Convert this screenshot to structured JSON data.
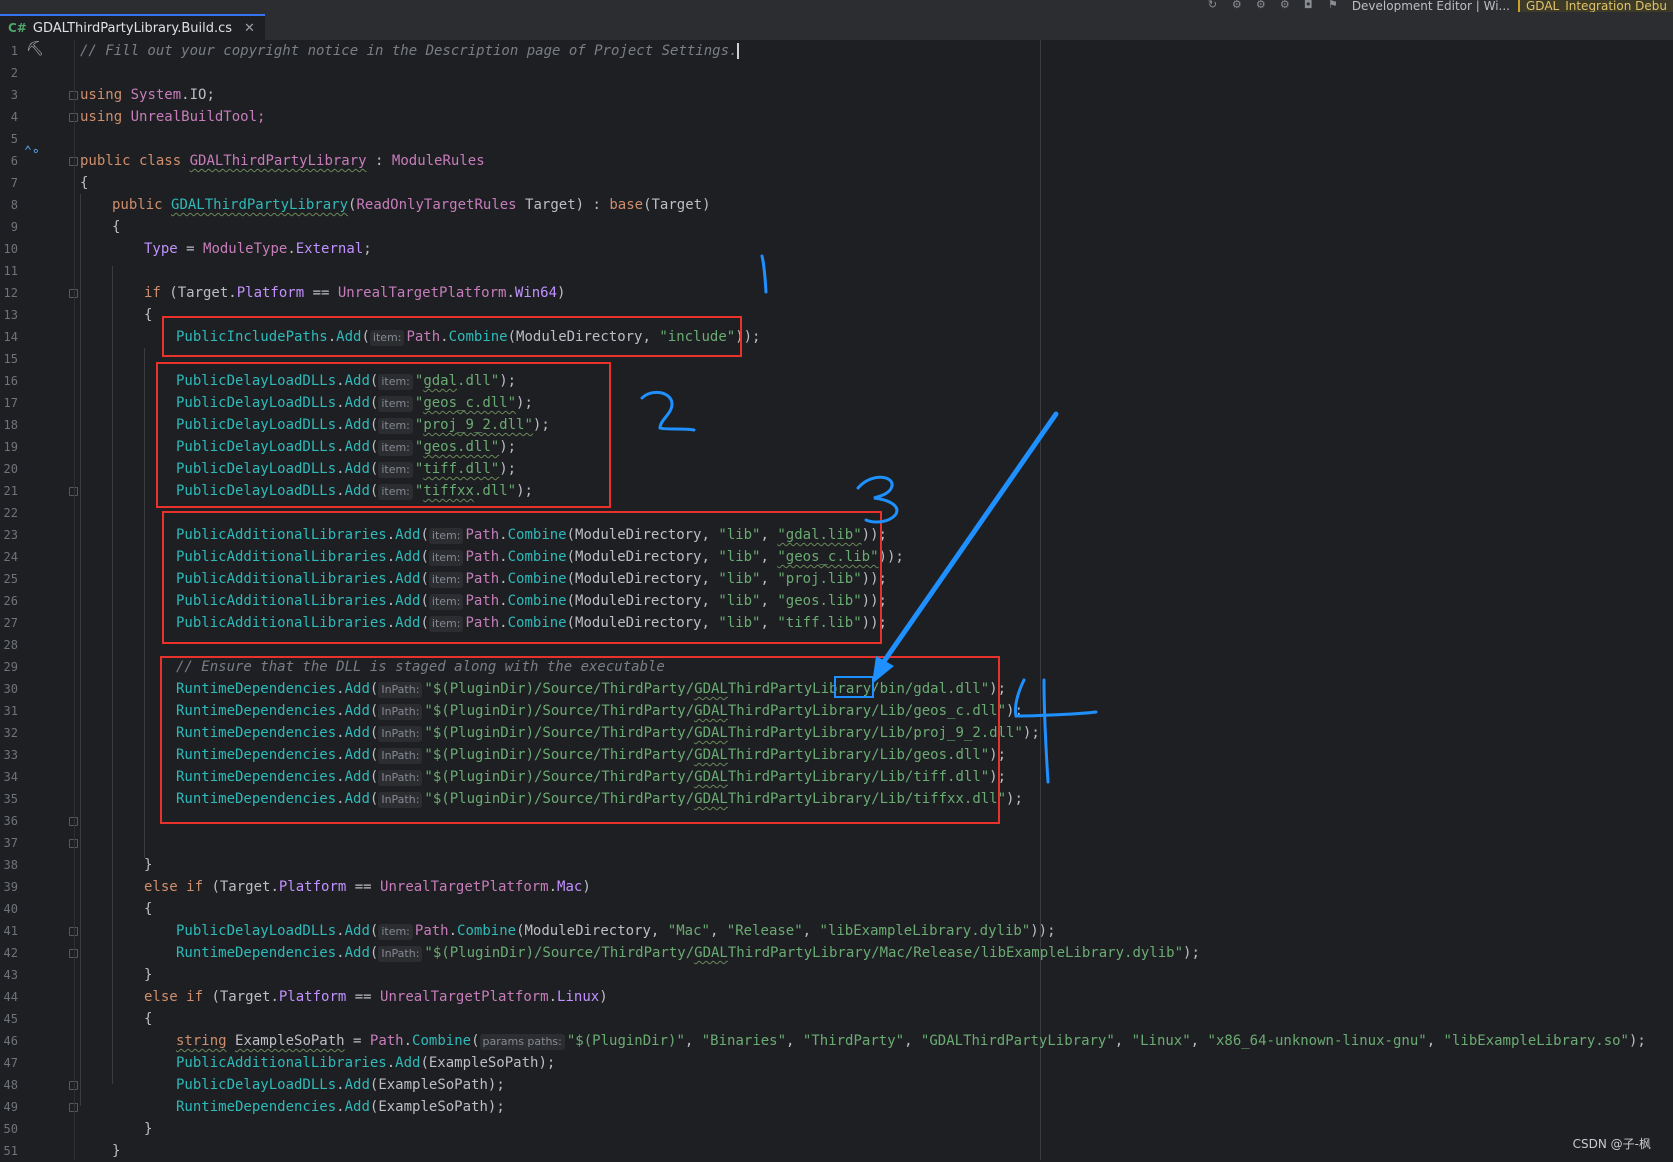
{
  "tab": {
    "lang": "C#",
    "filename": "GDALThirdPartyLibrary.Build.cs",
    "close": "✕"
  },
  "toolbar": {
    "build_config": "Development Editor | Wi...",
    "run_config": "GDAL_Integration Debu"
  },
  "lines": [
    {
      "n": "1"
    },
    {
      "n": "2"
    },
    {
      "n": "3"
    },
    {
      "n": "4"
    },
    {
      "n": "5"
    },
    {
      "n": "6"
    },
    {
      "n": "7"
    },
    {
      "n": "8"
    },
    {
      "n": "9"
    },
    {
      "n": "10"
    },
    {
      "n": "11"
    },
    {
      "n": "12"
    },
    {
      "n": "13"
    },
    {
      "n": "14"
    },
    {
      "n": "15"
    },
    {
      "n": "16"
    },
    {
      "n": "17"
    },
    {
      "n": "18"
    },
    {
      "n": "19"
    },
    {
      "n": "20"
    },
    {
      "n": "21"
    },
    {
      "n": "22"
    },
    {
      "n": "23"
    },
    {
      "n": "24"
    },
    {
      "n": "25"
    },
    {
      "n": "26"
    },
    {
      "n": "27"
    },
    {
      "n": "28"
    },
    {
      "n": "29"
    },
    {
      "n": "30"
    },
    {
      "n": "31"
    },
    {
      "n": "32"
    },
    {
      "n": "33"
    },
    {
      "n": "34"
    },
    {
      "n": "35"
    },
    {
      "n": "36"
    },
    {
      "n": "37"
    },
    {
      "n": "38"
    },
    {
      "n": "39"
    },
    {
      "n": "40"
    },
    {
      "n": "41"
    },
    {
      "n": "42"
    },
    {
      "n": "43"
    },
    {
      "n": "44"
    },
    {
      "n": "45"
    },
    {
      "n": "46"
    },
    {
      "n": "47"
    },
    {
      "n": "48"
    },
    {
      "n": "49"
    },
    {
      "n": "50"
    },
    {
      "n": "51"
    }
  ],
  "code": {
    "l1": "// Fill out your copyright notice in the Description page of Project Settings.",
    "l3a": "using",
    "l3b": " System",
    "l3c": ".IO;",
    "l4a": "using",
    "l4b": " UnrealBuildTool;",
    "l6a": "public class",
    "l6b": "GDALThirdPartyLibrary",
    "l6c": " : ",
    "l6d": "ModuleRules",
    "l7": "{",
    "l8a": "public ",
    "l8b": "GDALThirdPartyLibrary",
    "l8c": "(",
    "l8d": "ReadOnlyTargetRules",
    "l8e": " Target) : ",
    "l8f": "base",
    "l8g": "(Target)",
    "l9": "{",
    "l10a": "Type",
    "l10b": " = ",
    "l10c": "ModuleType",
    "l10d": ".",
    "l10e": "External",
    "l10f": ";",
    "l12a": "if",
    "l12b": " (Target.",
    "l12c": "Platform",
    "l12d": " == ",
    "l12e": "UnrealTargetPlatform",
    "l12f": ".",
    "l12g": "Win64",
    "l12h": ")",
    "l13": "{",
    "l14a": "PublicIncludePaths",
    "l14b": ".",
    "l14c": "Add",
    "l14d": "(",
    "l14hint": "item:",
    "l14e": "Path",
    "l14f": ".",
    "l14g": "Combine",
    "l14h": "(ModuleDirectory, ",
    "l14i": "\"include\"",
    "l14j": "));",
    "dll": [
      {
        "pre": "\"",
        "name": "gdal",
        "post": ".dll\"",
        "end": ");"
      },
      {
        "pre": "\"",
        "name": "geos_c.dll\"",
        "post": "",
        "end": ");"
      },
      {
        "pre": "\"",
        "name": "proj_9_2.dll\"",
        "post": "",
        "end": ");"
      },
      {
        "pre": "\"",
        "name": "geos.dll\"",
        "post": "",
        "end": ");"
      },
      {
        "pre": "\"",
        "name": "tiff.dll\"",
        "post": "",
        "end": ");"
      },
      {
        "pre": "\"",
        "name": "tiffxx",
        "post": ".dll\"",
        "end": ");"
      }
    ],
    "delay_obj": "PublicDelayLoadDLLs",
    "dot": ".",
    "add": "Add",
    "open": "(",
    "item_hint": "item:",
    "addlib_obj": "PublicAdditionalLibraries",
    "libs": [
      "\"gdal.lib\"",
      "\"geos_c.lib\"",
      "\"proj.lib\"",
      "\"geos.lib\"",
      "\"tiff.lib\""
    ],
    "lib_dir": "\"lib\"",
    "comma": ", ",
    "path": "Path",
    "combine": "Combine",
    "moddir": "(ModuleDirectory, ",
    "libend": "));",
    "l29": "// Ensure that the DLL is staged along with the executable",
    "rt_obj": "RuntimeDependencies",
    "inpath_hint": "InPath:",
    "rt_prefix": "\"$(PluginDir)/Source/ThirdParty/",
    "gdal": "GDAL",
    "tpl_rest": "ThirdPartyLibrary",
    "rt": [
      {
        "mid": "/bin",
        "tail": "/gdal.dll\""
      },
      {
        "mid": "/Lib/",
        "tail": "geos_c.dll\""
      },
      {
        "mid": "/Lib/",
        "tail": "proj_9_2.dll\""
      },
      {
        "mid": "/Lib/",
        "tail": "geos.dll\""
      },
      {
        "mid": "/Lib/",
        "tail": "tiff.dll\""
      },
      {
        "mid": "/Lib/",
        "tail": "tiffxx.dll\""
      }
    ],
    "rtend": ");",
    "l36": "}",
    "l37a": "else if",
    "l37b": " (Target.",
    "l37c": "Platform",
    "l37d": " == ",
    "l37e": "UnrealTargetPlatform",
    "l37f": ".",
    "l37g": "Mac",
    "l37h": ")",
    "l38": "{",
    "l39a": "\"Mac\"",
    "l39b": "\"Release\"",
    "l39c": "\"libExampleLibrary.dylib\"",
    "l40a": "ThirdPartyLibrary/Mac/Release/libExampleLibrary.dylib\"",
    "l41": "}",
    "l42g": "Linux",
    "l43": "{",
    "l44a": "string",
    "l44b": "ExampleSoPath",
    "l44c": " = ",
    "l44hint": "params paths:",
    "l44s1": "\"$(PluginDir)\"",
    "l44s2": "\"Binaries\"",
    "l44s3": "\"ThirdParty\"",
    "l44s4": "\"GDALThirdPartyLibrary\"",
    "l44s5": "\"Linux\"",
    "l44s6": "\"x86_64-unknown-linux-gnu\"",
    "l44s7": "\"libExampleLibrary.so\"",
    "l45b": "(ExampleSoPath);",
    "l48": "}",
    "l49": "}",
    "l50": "}"
  },
  "annotations": {
    "n1": "1",
    "n2": "2",
    "n3": "3",
    "n4": "4"
  },
  "watermark": "CSDN @子-枫"
}
